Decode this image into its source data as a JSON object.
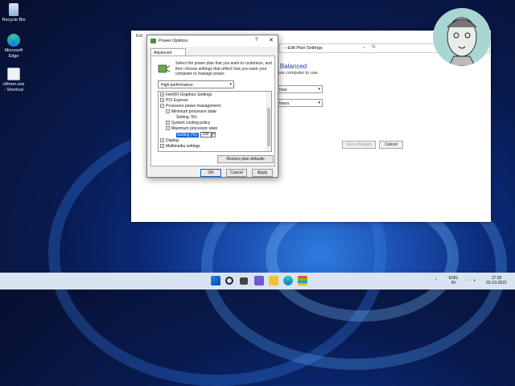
{
  "desktop": {
    "icons": [
      {
        "label": "Recycle Bin"
      },
      {
        "label": "Microsoft Edge"
      },
      {
        "label": "ctfmon.exe - Shortcut"
      }
    ]
  },
  "background_window": {
    "title": "Edi",
    "address": "Edit Plan Settings",
    "plan_title": "r Balanced",
    "plan_desc": "your computer to use.",
    "select1": "hour",
    "select2": "hours",
    "save_label": "Save changes",
    "cancel_label": "Cancel"
  },
  "dialog": {
    "title": "Power Options",
    "help": "?",
    "close": "✕",
    "tab": "Advanced settings",
    "intro": "Select the power plan that you want to customize, and then choose settings that reflect how you want your computer to manage power.",
    "plan": "High performance",
    "tree": [
      {
        "exp": "+",
        "label": "Intel(R) Graphics Settings"
      },
      {
        "exp": "+",
        "label": "PCI Express"
      },
      {
        "exp": "−",
        "label": "Processor power management"
      },
      {
        "exp": "−",
        "label": "Minimum processor state"
      },
      {
        "exp": "",
        "label": "Setting: 5%"
      },
      {
        "exp": "+",
        "label": "System cooling policy"
      },
      {
        "exp": "−",
        "label": "Maximum processor state"
      },
      {
        "exp": "",
        "label": "Setting (%):"
      },
      {
        "exp": "+",
        "label": "Display"
      },
      {
        "exp": "+",
        "label": "Multimedia settings"
      }
    ],
    "spin_value": "100",
    "restore": "Restore plan defaults",
    "ok": "OK",
    "cancel": "Cancel",
    "apply": "Apply"
  },
  "taskbar": {
    "lang1": "ENG",
    "lang2": "IN",
    "time": "17:30",
    "date": "02-10-2022"
  }
}
